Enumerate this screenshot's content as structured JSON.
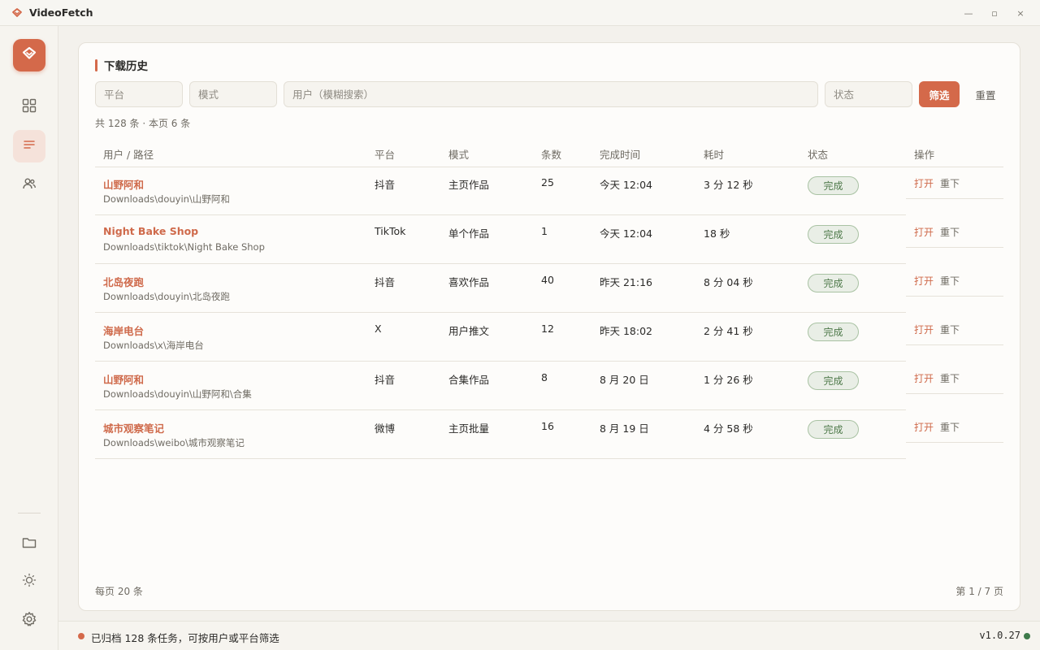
{
  "app": {
    "title": "VideoFetch",
    "icons": {
      "logo": "heart-diamond-icon",
      "minimize": "minimize-icon",
      "maximize": "maximize-icon",
      "close": "close-icon"
    },
    "window_controls": {
      "minimize": "—",
      "maximize": "▫",
      "close": "×"
    }
  },
  "sidebar": {
    "items": [
      {
        "name": "grid",
        "icon": "grid-icon",
        "active": false
      },
      {
        "name": "history",
        "icon": "list-icon",
        "active": true
      },
      {
        "name": "users",
        "icon": "users-icon",
        "active": false
      }
    ],
    "bottom": [
      {
        "name": "folder",
        "icon": "folder-icon"
      },
      {
        "name": "theme",
        "icon": "sun-icon"
      },
      {
        "name": "settings",
        "icon": "gear-icon"
      }
    ]
  },
  "history": {
    "title": "下载历史",
    "filters": {
      "platform_placeholder": "平台",
      "mode_placeholder": "模式",
      "user_placeholder": "用户（模糊搜索）",
      "status_placeholder": "状态",
      "filter_label": "筛选",
      "reset_label": "重置"
    },
    "summary": "共 128 条 · 本页 6 条",
    "columns": [
      "用户 / 路径",
      "平台",
      "模式",
      "条数",
      "完成时间",
      "耗时",
      "状态",
      "操作"
    ],
    "rows": [
      {
        "user": "山野阿和",
        "path": "Downloads\\douyin\\山野阿和",
        "platform": "抖音",
        "mode": "主页作品",
        "count": "25",
        "time": "今天 12:04",
        "duration": "3 分 12 秒",
        "status": "完成"
      },
      {
        "user": "Night Bake Shop",
        "path": "Downloads\\tiktok\\Night Bake Shop",
        "platform": "TikTok",
        "mode": "单个作品",
        "count": "1",
        "time": "今天 12:04",
        "duration": "18 秒",
        "status": "完成"
      },
      {
        "user": "北岛夜跑",
        "path": "Downloads\\douyin\\北岛夜跑",
        "platform": "抖音",
        "mode": "喜欢作品",
        "count": "40",
        "time": "昨天 21:16",
        "duration": "8 分 04 秒",
        "status": "完成"
      },
      {
        "user": "海岸电台",
        "path": "Downloads\\x\\海岸电台",
        "platform": "X",
        "mode": "用户推文",
        "count": "12",
        "time": "昨天 18:02",
        "duration": "2 分 41 秒",
        "status": "完成"
      },
      {
        "user": "山野阿和",
        "path": "Downloads\\douyin\\山野阿和\\合集",
        "platform": "抖音",
        "mode": "合集作品",
        "count": "8",
        "time": "8 月 20 日",
        "duration": "1 分 26 秒",
        "status": "完成"
      },
      {
        "user": "城市观察笔记",
        "path": "Downloads\\weibo\\城市观察笔记",
        "platform": "微博",
        "mode": "主页批量",
        "count": "16",
        "time": "8 月 19 日",
        "duration": "4 分 58 秒",
        "status": "完成"
      }
    ],
    "actions": {
      "open": "打开",
      "redownload": "重下"
    },
    "per_page": "每页 20 条",
    "page_indicator": "第 1 / 7 页"
  },
  "statusbar": {
    "message": "已归档 128 条任务，可按用户或平台筛选",
    "version": "v1.0.27"
  },
  "colors": {
    "accent": "#d4694a",
    "success": "#4f7a4b",
    "online": "#3e7a4a"
  }
}
